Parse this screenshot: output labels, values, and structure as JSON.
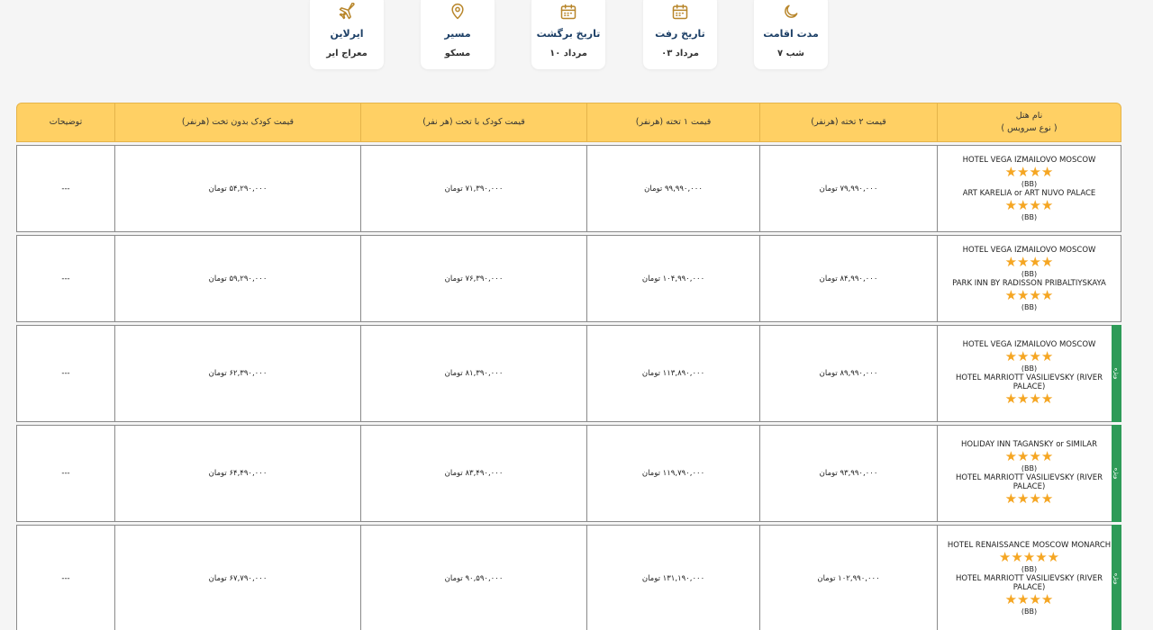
{
  "info_cards": [
    {
      "label": "ایرلاین",
      "value": "معراج ایر",
      "icon": "plane-icon"
    },
    {
      "label": "مسیر",
      "value": "مسکو",
      "icon": "location-pin-icon"
    },
    {
      "label": "تاریخ برگشت",
      "value": "۱۰ مرداد",
      "icon": "calendar-icon"
    },
    {
      "label": "تاریخ رفت",
      "value": "۰۳ مرداد",
      "icon": "calendar-icon"
    },
    {
      "label": "مدت اقامت",
      "value": "۷ شب",
      "icon": "moon-icon"
    }
  ],
  "table": {
    "headers": {
      "notes": "توضیحات",
      "child_no_bed": "قیمت کودک بدون تخت (هرنفر)",
      "child_bed": "قیمت کودک با تخت (هر نفر)",
      "single": "قیمت ۱ تخته (هرنفر)",
      "double": "قیمت ۲ تخته (هرنفر)",
      "hotel_line1": "نام هتل",
      "hotel_line2": "( نوع سرویس )"
    },
    "rows": [
      {
        "hotels": [
          {
            "name": "HOTEL VEGA IZMAILOVO MOSCOW",
            "stars": "★★★★",
            "service": "(BB)"
          },
          {
            "name": "ART KARELIA or ART NUVO PALACE",
            "stars": "★★★★",
            "service": "(BB)"
          }
        ],
        "double": "۷۹,۹۹۰,۰۰۰ تومان",
        "single": "۹۹,۹۹۰,۰۰۰ تومان",
        "child_bed": "۷۱,۳۹۰,۰۰۰ تومان",
        "child_no_bed": "۵۴,۲۹۰,۰۰۰ تومان",
        "notes": "---",
        "badge": ""
      },
      {
        "hotels": [
          {
            "name": "HOTEL VEGA IZMAILOVO MOSCOW",
            "stars": "★★★★",
            "service": "(BB)"
          },
          {
            "name": "PARK INN BY RADISSON PRIBALTIYSKAYA",
            "stars": "★★★★",
            "service": "(BB)"
          }
        ],
        "double": "۸۴,۹۹۰,۰۰۰ تومان",
        "single": "۱۰۴,۹۹۰,۰۰۰ تومان",
        "child_bed": "۷۶,۳۹۰,۰۰۰ تومان",
        "child_no_bed": "۵۹,۲۹۰,۰۰۰ تومان",
        "notes": "---",
        "badge": ""
      },
      {
        "hotels": [
          {
            "name": "HOTEL VEGA IZMAILOVO MOSCOW",
            "stars": "★★★★",
            "service": "(BB)"
          },
          {
            "name": "HOTEL MARRIOTT VASILIEVSKY (RIVER PALACE)",
            "stars": "★★★★",
            "service": ""
          }
        ],
        "double": "۸۹,۹۹۰,۰۰۰ تومان",
        "single": "۱۱۳,۸۹۰,۰۰۰ تومان",
        "child_bed": "۸۱,۳۹۰,۰۰۰ تومان",
        "child_no_bed": "۶۲,۳۹۰,۰۰۰ تومان",
        "notes": "---",
        "badge": "ویژه"
      },
      {
        "hotels": [
          {
            "name": "HOLIDAY INN TAGANSKY or SIMILAR",
            "stars": "★★★★",
            "service": "(BB)"
          },
          {
            "name": "HOTEL MARRIOTT VASILIEVSKY (RIVER PALACE)",
            "stars": "★★★★",
            "service": ""
          }
        ],
        "double": "۹۳,۹۹۰,۰۰۰ تومان",
        "single": "۱۱۹,۷۹۰,۰۰۰ تومان",
        "child_bed": "۸۳,۴۹۰,۰۰۰ تومان",
        "child_no_bed": "۶۴,۴۹۰,۰۰۰ تومان",
        "notes": "---",
        "badge": "ویژه"
      },
      {
        "hotels": [
          {
            "name": "HOTEL RENAISSANCE MOSCOW MONARCH",
            "stars": "★★★★★",
            "service": "(BB)"
          },
          {
            "name": "HOTEL MARRIOTT VASILIEVSKY (RIVER PALACE)",
            "stars": "★★★★",
            "service": "(BB)"
          }
        ],
        "double": "۱۰۲,۹۹۰,۰۰۰ تومان",
        "single": "۱۳۱,۱۹۰,۰۰۰ تومان",
        "child_bed": "۹۰,۵۹۰,۰۰۰ تومان",
        "child_no_bed": "۶۷,۷۹۰,۰۰۰ تومان",
        "notes": "---",
        "badge": "ویژه"
      }
    ]
  },
  "colors": {
    "header_bg": "#ffd064",
    "star": "#f5a623",
    "badge": "#2e9b58",
    "card_label": "#1c3f66"
  }
}
